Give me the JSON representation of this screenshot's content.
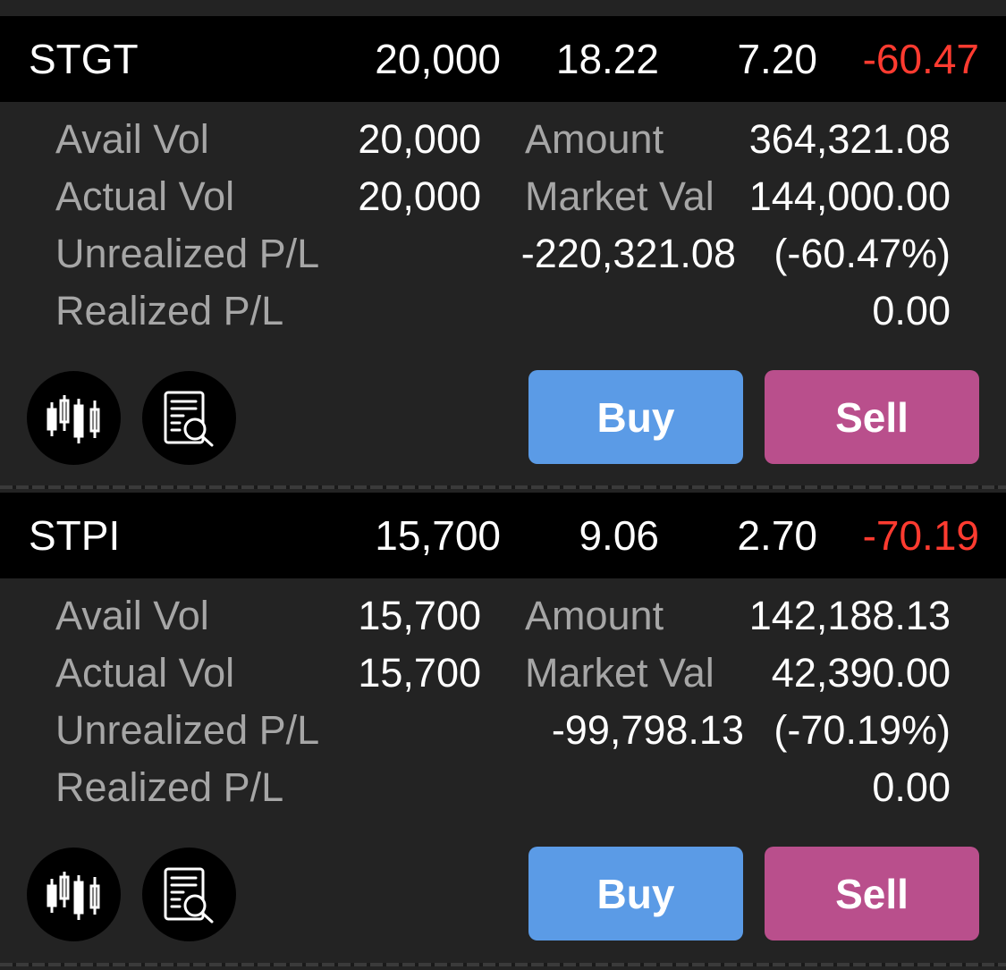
{
  "positions": [
    {
      "symbol": "STGT",
      "volume": "20,000",
      "avg_cost": "18.22",
      "last_price": "7.20",
      "pl_percent": "-60.47",
      "avail_vol_label": "Avail Vol",
      "avail_vol": "20,000",
      "actual_vol_label": "Actual Vol",
      "actual_vol": "20,000",
      "amount_label": "Amount",
      "amount": "364,321.08",
      "market_val_label": "Market Val",
      "market_val": "144,000.00",
      "unrealized_label": "Unrealized P/L",
      "unrealized_value": "-220,321.08",
      "unrealized_pct": "(-60.47%)",
      "realized_label": "Realized P/L",
      "realized_value": "0.00",
      "buy_label": "Buy",
      "sell_label": "Sell"
    },
    {
      "symbol": "STPI",
      "volume": "15,700",
      "avg_cost": "9.06",
      "last_price": "2.70",
      "pl_percent": "-70.19",
      "avail_vol_label": "Avail Vol",
      "avail_vol": "15,700",
      "actual_vol_label": "Actual Vol",
      "actual_vol": "15,700",
      "amount_label": "Amount",
      "amount": "142,188.13",
      "market_val_label": "Market Val",
      "market_val": "42,390.00",
      "unrealized_label": "Unrealized P/L",
      "unrealized_value": "-99,798.13",
      "unrealized_pct": "(-70.19%)",
      "realized_label": "Realized P/L",
      "realized_value": "0.00",
      "buy_label": "Buy",
      "sell_label": "Sell"
    }
  ],
  "icons": {
    "chart": "candlestick-chart-icon",
    "detail": "document-search-icon"
  },
  "colors": {
    "negative": "#ff3b30",
    "realized": "#ffff3c",
    "buy": "#5b9be6",
    "sell": "#b94f8c"
  }
}
